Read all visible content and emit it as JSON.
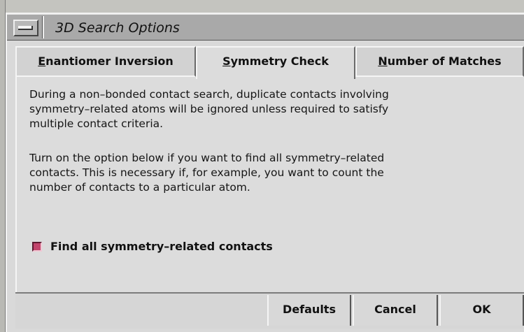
{
  "window": {
    "title": "3D Search Options"
  },
  "tabs": [
    {
      "underlined": "E",
      "rest": "nantiomer Inversion",
      "active": false
    },
    {
      "underlined": "S",
      "rest": "ymmetry Check",
      "active": true
    },
    {
      "underlined": "N",
      "rest": "umber of Matches",
      "active": false
    }
  ],
  "panel": {
    "paragraph1": "During a non–bonded contact search, duplicate contacts involving\nsymmetry–related atoms will be ignored unless required to satisfy\nmultiple contact criteria.",
    "paragraph2": "Turn on the option below if you want to find all symmetry–related\ncontacts. This is necessary if, for example, you want to count the\nnumber of contacts to a particular atom.",
    "checkbox": {
      "label": "Find all symmetry–related contacts",
      "checked": true,
      "color": "#c2456c"
    }
  },
  "buttons": {
    "defaults": "Defaults",
    "cancel": "Cancel",
    "ok": "OK"
  }
}
